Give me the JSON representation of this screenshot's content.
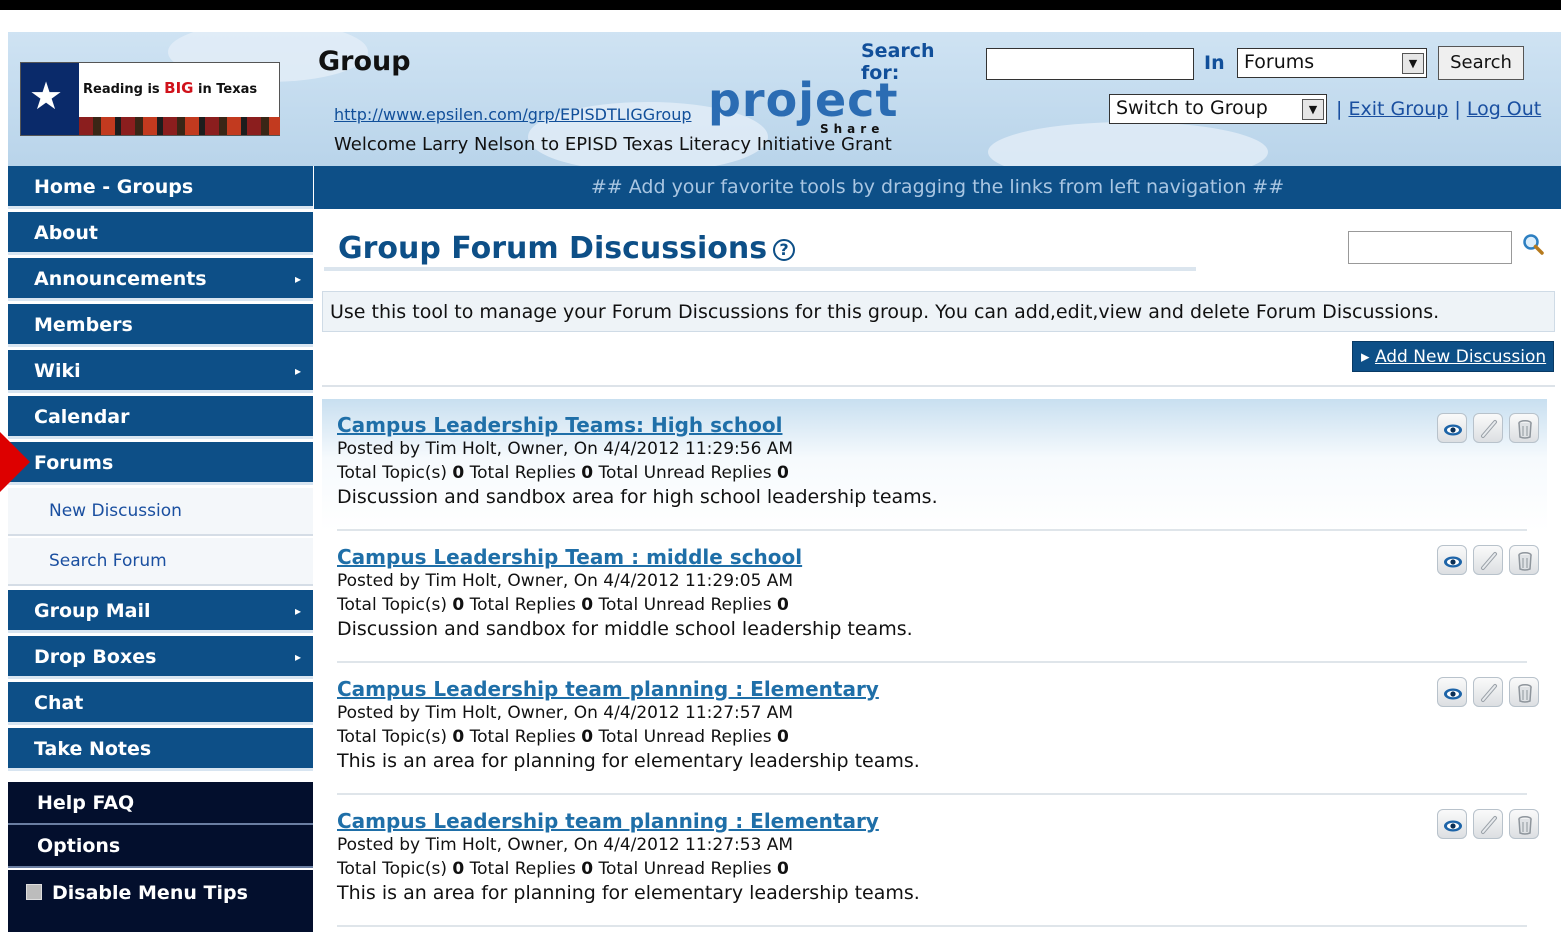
{
  "header": {
    "group_title": "Group",
    "group_url": "http://www.epsilen.com/grp/EPISDTLIGGroup",
    "welcome": "Welcome Larry Nelson to EPISD Texas Literacy Initiative Grant",
    "logo_text_pre": "Reading is ",
    "logo_text_big": "BIG",
    "logo_text_post": " in Texas",
    "project_logo": "project",
    "project_share": "Share",
    "search_label": "Search for:",
    "search_value": "",
    "in_label": "In",
    "in_select": "Forums",
    "search_button": "Search",
    "switch_select": "Switch to Group",
    "exit_group": "Exit Group",
    "log_out": "Log Out"
  },
  "sidebar": {
    "items": [
      {
        "label": "Home - Groups"
      },
      {
        "label": "About"
      },
      {
        "label": "Announcements"
      },
      {
        "label": "Members"
      },
      {
        "label": "Wiki"
      },
      {
        "label": "Calendar"
      },
      {
        "label": "Forums"
      },
      {
        "label": "New Discussion"
      },
      {
        "label": "Search Forum"
      },
      {
        "label": "Group Mail"
      },
      {
        "label": "Drop Boxes"
      },
      {
        "label": "Chat"
      },
      {
        "label": "Take Notes"
      },
      {
        "label": "Help FAQ"
      },
      {
        "label": "Options"
      },
      {
        "label": "Disable Menu Tips"
      }
    ]
  },
  "favbar_text": "## Add your favorite tools by dragging the links from left navigation ##",
  "main": {
    "title": "Group Forum Discussions",
    "help_glyph": "?",
    "mini_search_value": "",
    "info": "Use this tool to manage your Forum Discussions for this group. You can add,edit,view and delete Forum Discussions.",
    "add_button": "Add New Discussion",
    "discussions": [
      {
        "title": "Campus Leadership Teams: High school",
        "meta": "Posted by Tim Holt, Owner,   On 4/4/2012 11:29:56 AM",
        "topics_label": "Total Topic(s)",
        "topics": "0",
        "replies_label": "Total Replies",
        "replies": "0",
        "unread_label": "Total Unread Replies",
        "unread": "0",
        "desc": "Discussion and sandbox area for high school leadership teams."
      },
      {
        "title": "Campus Leadership Team : middle school",
        "meta": "Posted by Tim Holt, Owner,   On 4/4/2012 11:29:05 AM",
        "topics_label": "Total Topic(s)",
        "topics": "0",
        "replies_label": "Total Replies",
        "replies": "0",
        "unread_label": "Total Unread Replies",
        "unread": "0",
        "desc": "Discussion and sandbox for middle school leadership teams."
      },
      {
        "title": "Campus Leadership team planning : Elementary",
        "meta": "Posted by Tim Holt, Owner,   On 4/4/2012 11:27:57 AM",
        "topics_label": "Total Topic(s)",
        "topics": "0",
        "replies_label": "Total Replies",
        "replies": "0",
        "unread_label": "Total Unread Replies",
        "unread": "0",
        "desc": "This is an area for planning for elementary leadership teams."
      },
      {
        "title": "Campus Leadership team planning : Elementary",
        "meta": "Posted by Tim Holt, Owner,   On 4/4/2012 11:27:53 AM",
        "topics_label": "Total Topic(s)",
        "topics": "0",
        "replies_label": "Total Replies",
        "replies": "0",
        "unread_label": "Total Unread Replies",
        "unread": "0",
        "desc": "This is an area for planning for elementary leadership teams."
      }
    ]
  },
  "icons": {
    "view": "eye-icon",
    "edit": "pencil-icon",
    "delete": "trash-icon",
    "search": "magnifier-icon",
    "submenu": "chevron-right-icon",
    "state_star": "star-icon"
  },
  "colors": {
    "nav_blue": "#0d4f87",
    "nav_dark": "#030f2d",
    "link_blue": "#1f6fa8",
    "header_bg": "#b9d4ea",
    "marker_red": "#dd0000"
  }
}
